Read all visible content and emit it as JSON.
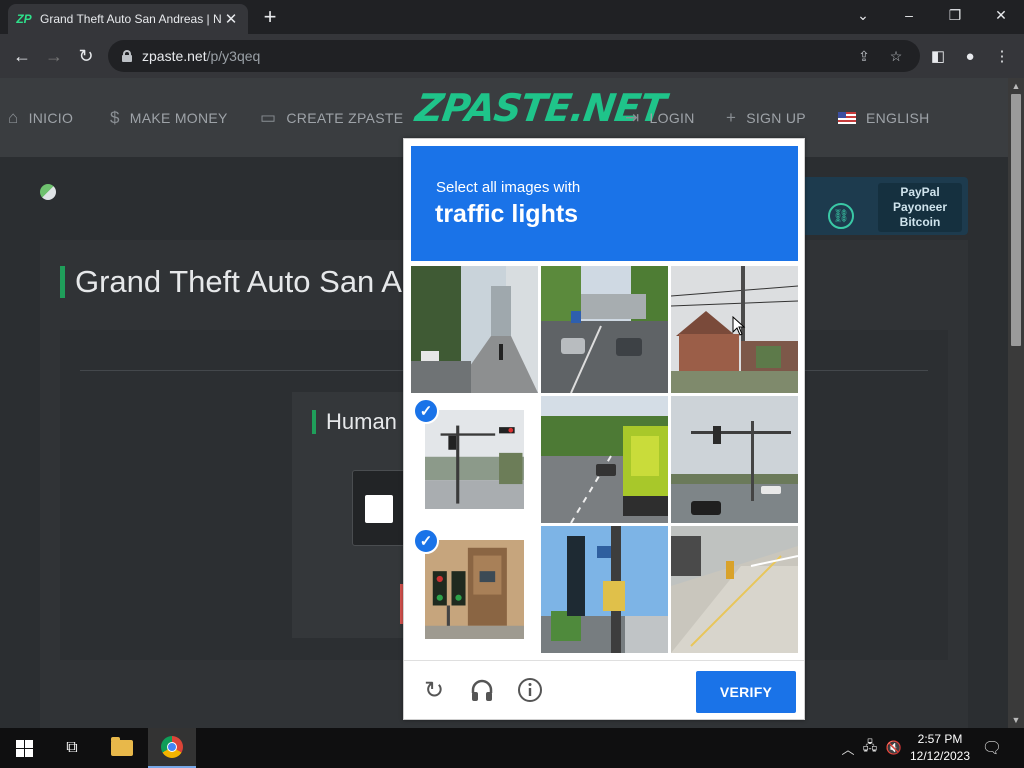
{
  "browser": {
    "tab_title": "Grand Theft Auto San Andreas | N",
    "url_host": "zpaste.net",
    "url_path": "/p/y3qeq",
    "favicon": "zp-logo",
    "window_controls": {
      "minimize": "–",
      "maximize": "❐",
      "close": "✕"
    }
  },
  "site": {
    "logo_text": "ZPASTE.NET",
    "nav": [
      {
        "label": "INICIO",
        "icon": "home-icon"
      },
      {
        "label": "MAKE MONEY",
        "icon": "dollar-icon"
      },
      {
        "label": "CREATE ZPASTE",
        "icon": "folder-icon"
      },
      {
        "label": "LOGIN",
        "icon": "login-icon"
      },
      {
        "label": "SIGN UP",
        "icon": "plus-icon"
      },
      {
        "label": "ENGLISH",
        "icon": "us-flag-icon"
      }
    ],
    "ad": {
      "lines": [
        "PayPal",
        "Payoneer",
        "Bitcoin"
      ]
    },
    "page_title": "Grand Theft Auto San Andreas | N",
    "human_title": "Human"
  },
  "captcha": {
    "instruction": "Select all images with",
    "target": "traffic lights",
    "verify_label": "VERIFY",
    "tiles": [
      {
        "scene": "city-sidewalk",
        "selected": false
      },
      {
        "scene": "highway-cars",
        "selected": false
      },
      {
        "scene": "house-power-lines",
        "selected": false
      },
      {
        "scene": "traffic-signal-intersection",
        "selected": true
      },
      {
        "scene": "road-truck",
        "selected": false
      },
      {
        "scene": "traffic-light-car",
        "selected": false
      },
      {
        "scene": "traffic-light-building",
        "selected": true
      },
      {
        "scene": "traffic-light-pole",
        "selected": false
      },
      {
        "scene": "sidewalk-hydrant",
        "selected": false
      }
    ],
    "colors": {
      "accent": "#1a73e8"
    }
  },
  "taskbar": {
    "time": "2:57 PM",
    "date": "12/12/2023"
  }
}
